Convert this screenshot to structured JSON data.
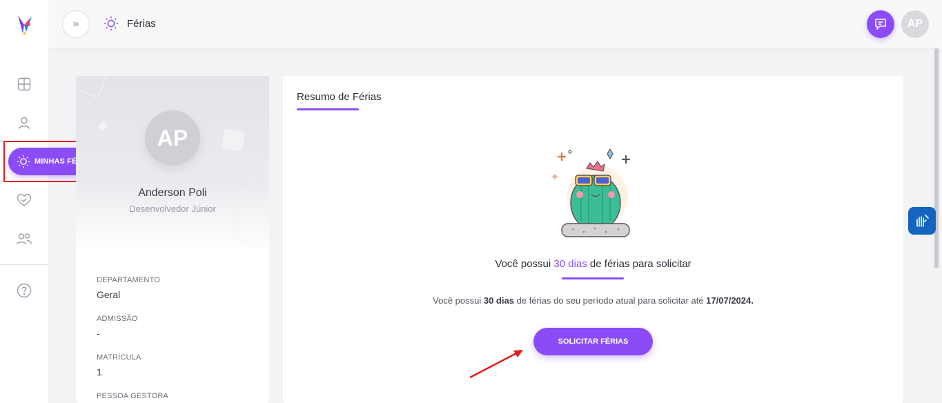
{
  "header": {
    "title": "Férias",
    "user_initials": "AP"
  },
  "sidebar": {
    "active_item_label": "MINHAS FÉRIAS",
    "items": [
      {
        "icon": "dashboard-grid-icon"
      },
      {
        "icon": "user-icon"
      },
      {
        "icon": "sun-icon",
        "label": "MINHAS FÉRIAS"
      },
      {
        "icon": "heart-check-icon"
      },
      {
        "icon": "users-icon"
      },
      {
        "icon": "help-icon"
      }
    ]
  },
  "profile": {
    "initials": "AP",
    "name": "Anderson Poli",
    "role": "Desenvolvedor Júnior",
    "fields": [
      {
        "label": "DEPARTAMENTO",
        "value": "Geral"
      },
      {
        "label": "ADMISSÃO",
        "value": "-"
      },
      {
        "label": "MATRÍCULA",
        "value": "1"
      },
      {
        "label": "PESSOA GESTORA",
        "value": ""
      }
    ]
  },
  "summary": {
    "tab_title": "Resumo de Férias",
    "headline_prefix": "Você possui ",
    "headline_days": "30 dias",
    "headline_suffix": " de férias para solicitar",
    "detail_prefix": "Você possui ",
    "detail_days": "30 dias",
    "detail_middle": " de férias do seu período atual para solicitar até ",
    "detail_date": "17/07/2024.",
    "button_label": "SOLICITAR FÉRIAS"
  },
  "colors": {
    "accent": "#8b4cf7",
    "highlight_border": "#e31b1b",
    "a11y_widget": "#1565c0"
  }
}
